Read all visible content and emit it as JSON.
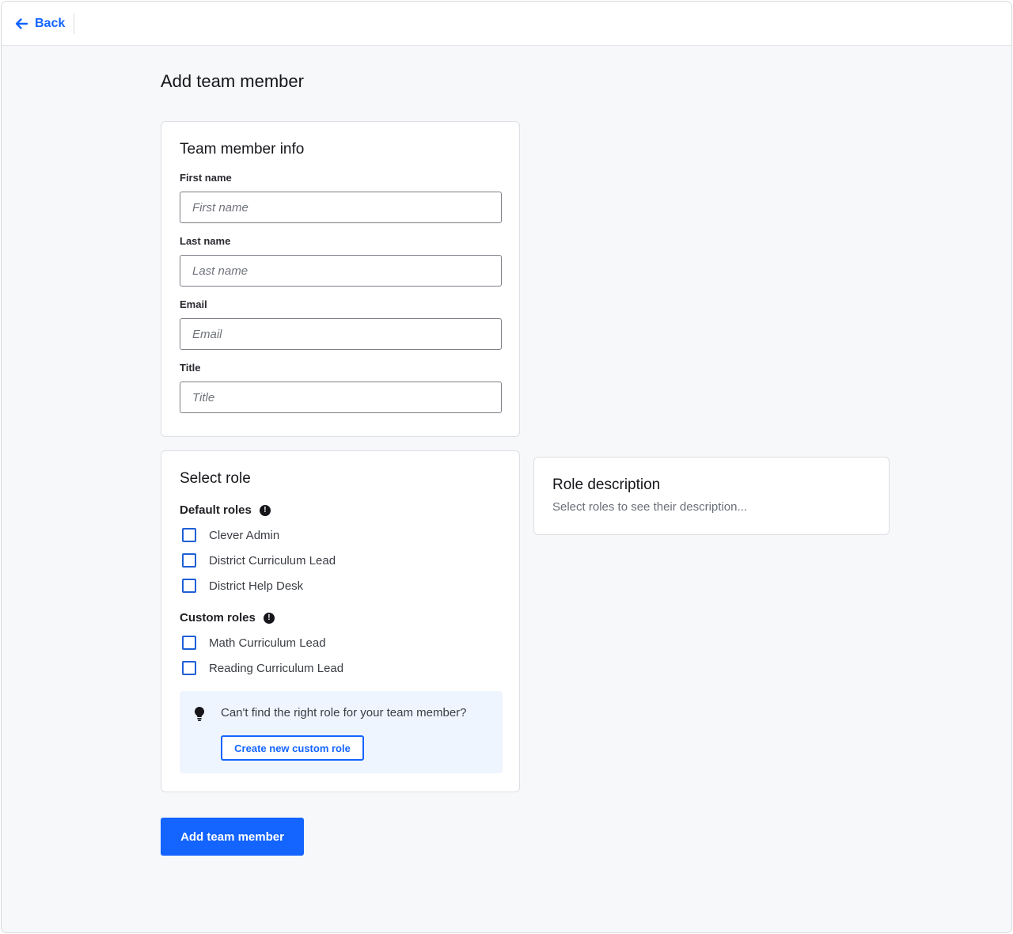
{
  "header": {
    "back_label": "Back"
  },
  "page": {
    "title": "Add team member"
  },
  "team_member_info": {
    "title": "Team member info",
    "fields": [
      {
        "label": "First name",
        "placeholder": "First name",
        "value": ""
      },
      {
        "label": "Last name",
        "placeholder": "Last name",
        "value": ""
      },
      {
        "label": "Email",
        "placeholder": "Email",
        "value": ""
      },
      {
        "label": "Title",
        "placeholder": "Title",
        "value": ""
      }
    ]
  },
  "select_role": {
    "title": "Select role",
    "default_roles_label": "Default roles",
    "default_roles": [
      {
        "label": "Clever Admin",
        "checked": false
      },
      {
        "label": "District Curriculum Lead",
        "checked": false
      },
      {
        "label": "District Help Desk",
        "checked": false
      }
    ],
    "custom_roles_label": "Custom roles",
    "custom_roles": [
      {
        "label": "Math Curriculum Lead",
        "checked": false
      },
      {
        "label": "Reading Curriculum Lead",
        "checked": false
      }
    ],
    "hint": {
      "text": "Can't find the right role for your team member?",
      "button_label": "Create new custom role"
    }
  },
  "role_description": {
    "title": "Role description",
    "text": "Select roles to see their description..."
  },
  "footer": {
    "submit_label": "Add team member"
  },
  "colors": {
    "accent": "#1464ff",
    "background": "#f7f8fa",
    "hint_background": "#eef5fe"
  },
  "icons": {
    "back": "arrow-left-icon",
    "info": "info-icon",
    "hint": "lightbulb-icon"
  }
}
